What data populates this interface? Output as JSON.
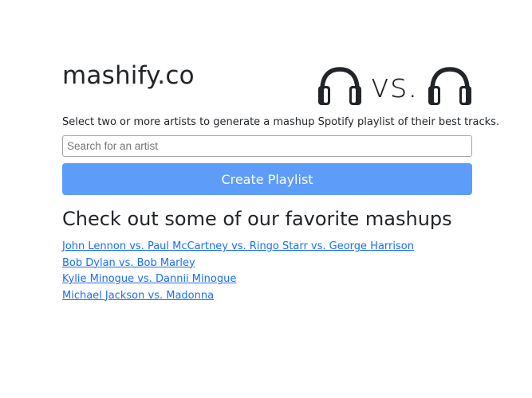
{
  "brand": "mashify.co",
  "logo": {
    "left_icon": "headphones-icon",
    "vs_text": "vs.",
    "right_icon": "headphones-icon"
  },
  "intro_text": "Select two or more artists to generate a mashup Spotify playlist of their best tracks.",
  "search": {
    "placeholder": "Search for an artist",
    "value": ""
  },
  "create_button_label": "Create Playlist",
  "favorites": {
    "heading": "Check out some of our favorite mashups",
    "items": [
      {
        "label": "John Lennon vs. Paul McCartney vs. Ringo Starr vs. George Harrison"
      },
      {
        "label": "Bob Dylan vs. Bob Marley"
      },
      {
        "label": "Kylie Minogue vs. Dannii Minogue"
      },
      {
        "label": "Michael Jackson vs. Madonna"
      }
    ]
  },
  "colors": {
    "text": "#212529",
    "button": "#5e9cfa",
    "link": "#1a6ef5"
  }
}
